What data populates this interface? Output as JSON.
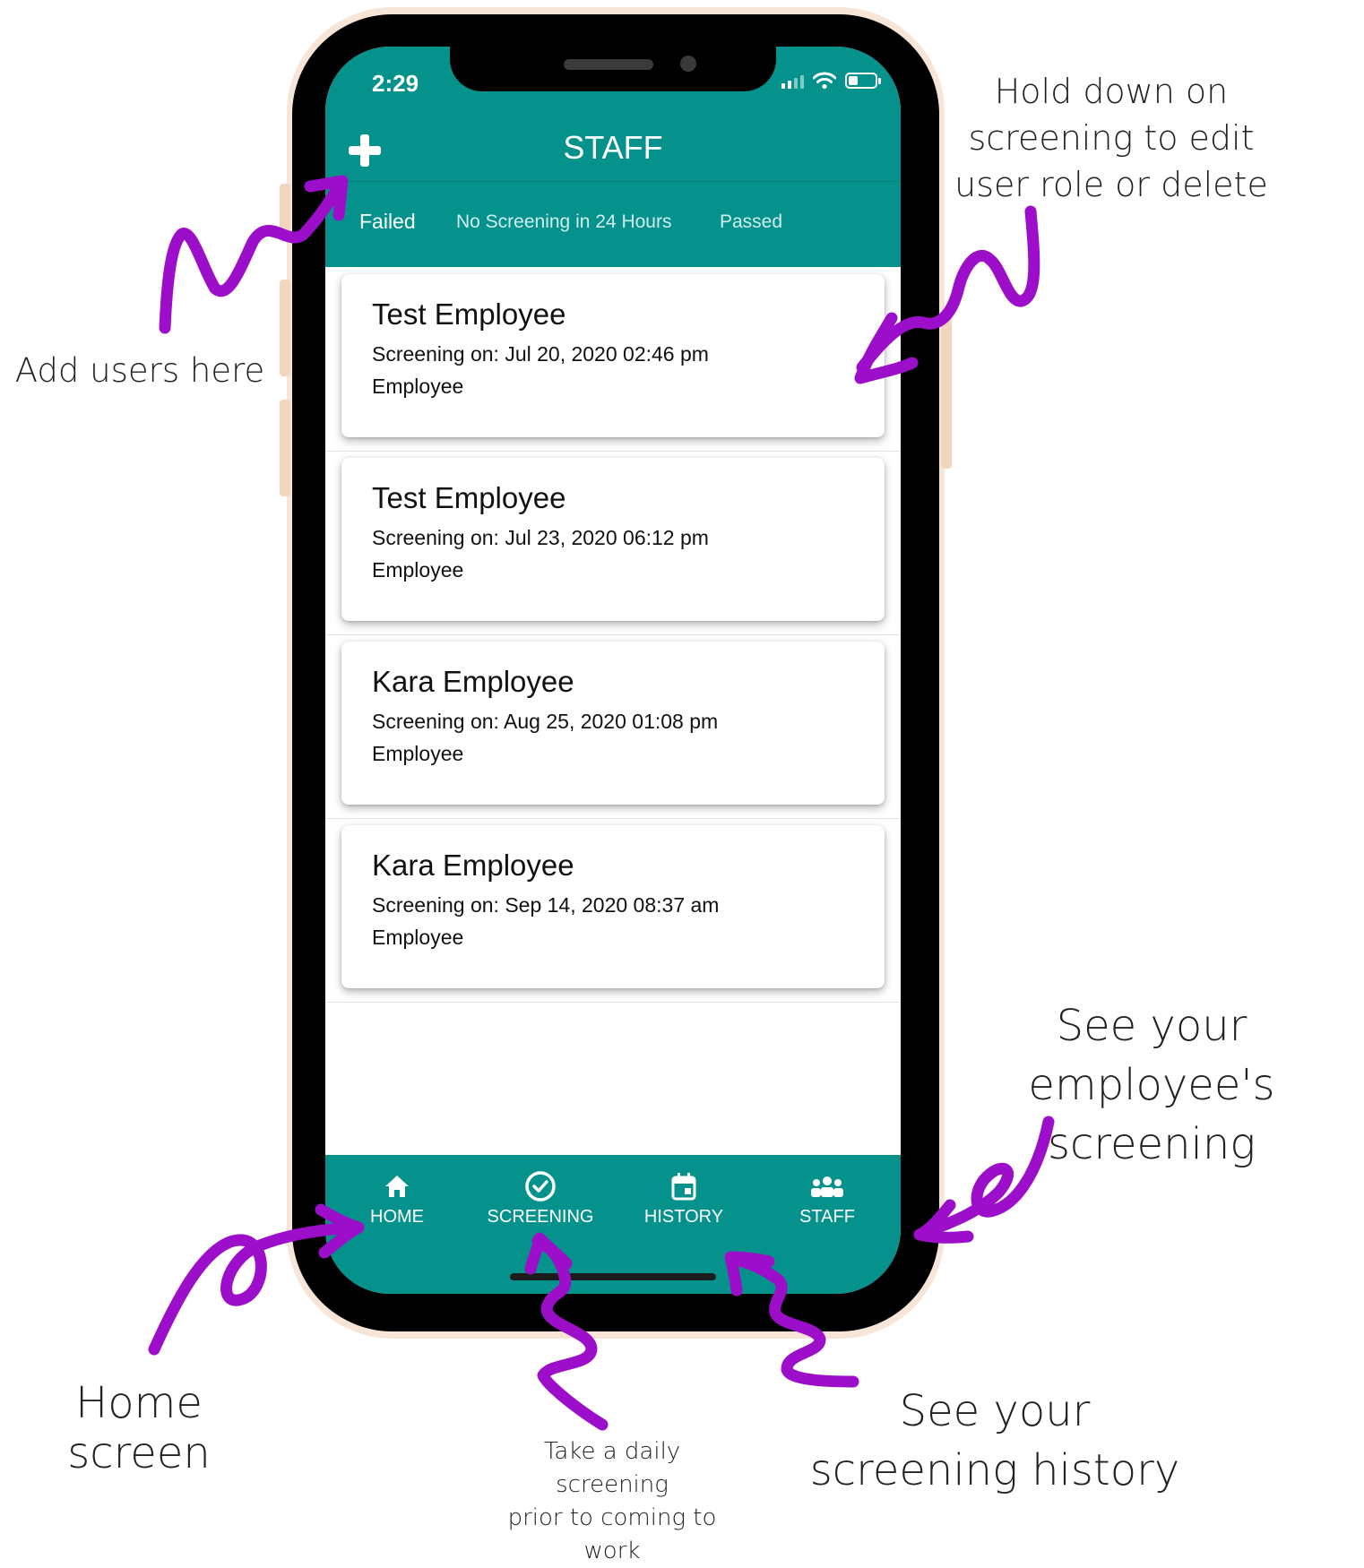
{
  "status_bar": {
    "time": "2:29"
  },
  "header": {
    "title": "STAFF"
  },
  "tabs": [
    {
      "label": "Failed",
      "active": true
    },
    {
      "label": "No Screening in 24 Hours",
      "active": false
    },
    {
      "label": "Passed",
      "active": false
    }
  ],
  "screenings": [
    {
      "name": "Test Employee",
      "date": "Screening on: Jul 20, 2020 02:46 pm",
      "role": "Employee"
    },
    {
      "name": "Test Employee",
      "date": "Screening on: Jul 23, 2020 06:12 pm",
      "role": "Employee"
    },
    {
      "name": "Kara Employee",
      "date": "Screening on: Aug 25, 2020 01:08 pm",
      "role": "Employee"
    },
    {
      "name": "Kara Employee",
      "date": "Screening on: Sep 14, 2020 08:37 am",
      "role": "Employee"
    }
  ],
  "bottom_nav": [
    {
      "label": "HOME",
      "icon": "home-icon"
    },
    {
      "label": "SCREENING",
      "icon": "check-circle-icon"
    },
    {
      "label": "HISTORY",
      "icon": "calendar-icon"
    },
    {
      "label": "STAFF",
      "icon": "group-icon"
    }
  ],
  "annotations": {
    "hold_down": [
      "Hold down on",
      "screening to edit",
      "user role or delete"
    ],
    "add_users": "Add users here",
    "see_employee": [
      "See your",
      "employee's screening"
    ],
    "home_screen": "Home screen",
    "daily_screening": [
      "Take a daily",
      "screening",
      "prior to coming to",
      "work"
    ],
    "see_history": [
      "See your",
      "screening history"
    ]
  },
  "colors": {
    "teal": "#05928d",
    "arrow": "#9c0ec9",
    "phone_frame": "#f7e6d8"
  }
}
